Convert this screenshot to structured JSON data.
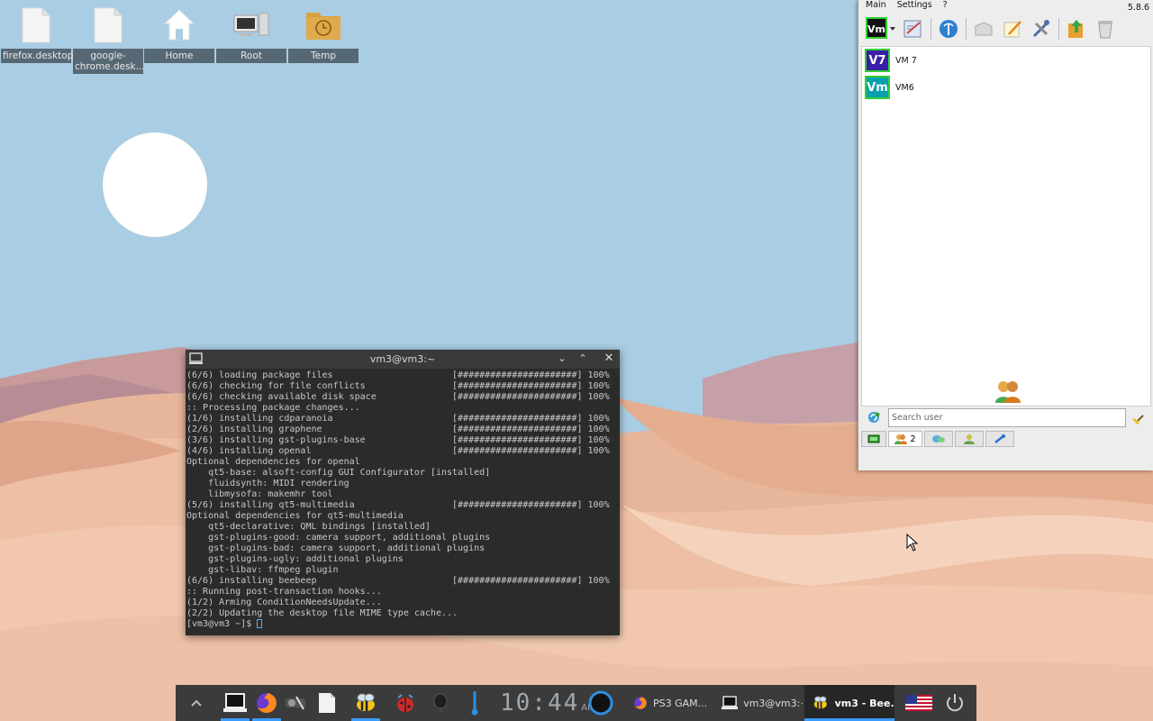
{
  "desktop": {
    "icons": [
      {
        "label": "firefox.desktop",
        "icon": "file-icon"
      },
      {
        "label": "google-chrome.desk...",
        "icon": "file-icon"
      },
      {
        "label": "Home",
        "icon": "home-icon"
      },
      {
        "label": "Root",
        "icon": "computer-icon"
      },
      {
        "label": "Temp",
        "icon": "folder-clock-icon"
      }
    ]
  },
  "terminal": {
    "title": "vm3@vm3:~",
    "lines": [
      "(6/6) loading package files                      [######################] 100%",
      "(6/6) checking for file conflicts                [######################] 100%",
      "(6/6) checking available disk space              [######################] 100%",
      ":: Processing package changes...",
      "(1/6) installing cdparanoia                      [######################] 100%",
      "(2/6) installing graphene                        [######################] 100%",
      "(3/6) installing gst-plugins-base                [######################] 100%",
      "(4/6) installing openal                          [######################] 100%",
      "Optional dependencies for openal",
      "    qt5-base: alsoft-config GUI Configurator [installed]",
      "    fluidsynth: MIDI rendering",
      "    libmysofa: makemhr tool",
      "(5/6) installing qt5-multimedia                  [######################] 100%",
      "Optional dependencies for qt5-multimedia",
      "    qt5-declarative: QML bindings [installed]",
      "    gst-plugins-good: camera support, additional plugins",
      "    gst-plugins-bad: camera support, additional plugins",
      "    gst-plugins-ugly: additional plugins",
      "    gst-libav: ffmpeg plugin",
      "(6/6) installing beebeep                         [######################] 100%",
      ":: Running post-transaction hooks...",
      "(1/2) Arming ConditionNeedsUpdate...",
      "(2/2) Updating the desktop file MIME type cache..."
    ],
    "prompt": "[vm3@vm3 ~]$ "
  },
  "beebeep": {
    "menu": [
      "Main",
      "Settings",
      "?"
    ],
    "version": "5.8.6",
    "users": [
      {
        "avatar": "V7",
        "name": "VM 7",
        "color": "#3a1fa8"
      },
      {
        "avatar": "Vm",
        "name": "VM6",
        "color": "#0a9fb0"
      }
    ],
    "search_placeholder": "Search user",
    "tab_users_count": "2"
  },
  "taskbar": {
    "clock_time": "10:44",
    "clock_ampm": "AM",
    "tasks": [
      {
        "label": "PS3 GAM...",
        "icon": "firefox-icon"
      },
      {
        "label": "vm3@vm3:~",
        "icon": "terminal-icon"
      },
      {
        "label": "vm3 - Bee...",
        "icon": "bee-icon"
      }
    ]
  },
  "colors": {
    "sky": "#a9cde2",
    "terminal_bg": "#2b2b2b",
    "taskbar_bg": "#3b3b3b",
    "accent": "#3b9cff",
    "online": "#2fd12f"
  }
}
